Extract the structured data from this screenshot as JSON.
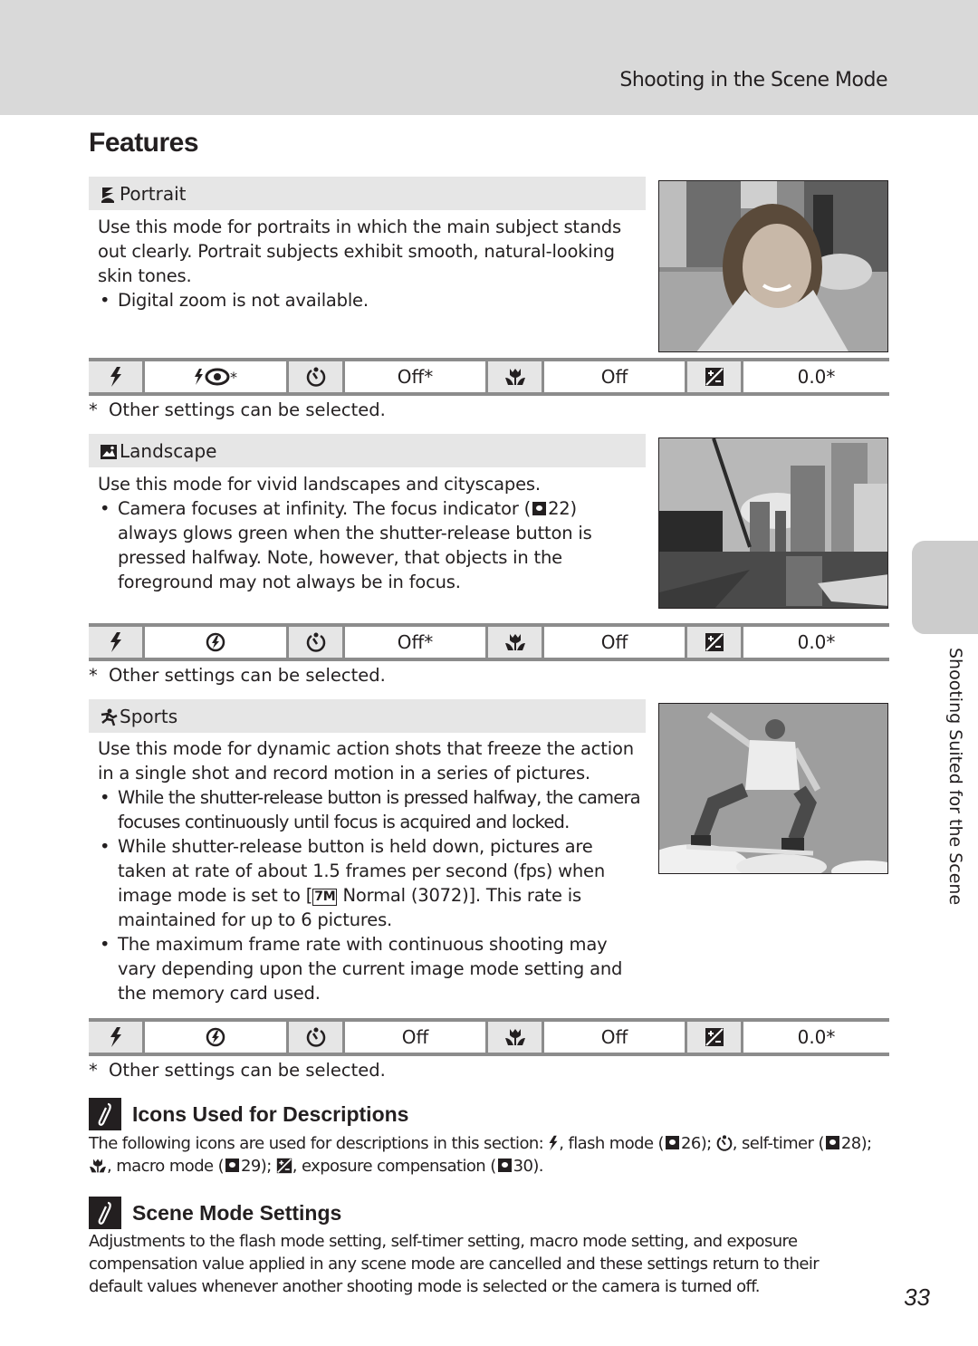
{
  "header": {
    "title": "Shooting in the Scene Mode"
  },
  "page_title": "Features",
  "sections": [
    {
      "id": "portrait",
      "icon": "portrait-mode-icon",
      "title": "Portrait",
      "intro": "Use this mode for portraits in which the main subject stands out clearly. Portrait subjects exhibit smooth, natural-looking skin tones.",
      "bullets": [
        "Digital zoom is not available."
      ],
      "photo_alt": "Smiling woman portrait in front of brick house",
      "settings": {
        "flash_value_icon": "red-eye-reduction-icon",
        "flash_value_suffix": "*",
        "self_timer": "Off*",
        "macro": "Off",
        "exposure": "0.0*"
      },
      "footnote": "Other settings can be selected."
    },
    {
      "id": "landscape",
      "icon": "landscape-mode-icon",
      "title": "Landscape",
      "intro": "Use this mode for vivid landscapes and cityscapes.",
      "bullets": [
        {
          "pre": "Camera focuses at infinity. The focus indicator (",
          "ref": "22",
          "post": ") always glows green when the shutter-release button is pressed halfway. Note, however, that objects in the foreground may not always be in focus."
        }
      ],
      "photo_alt": "Harbor with sailboats and city skyscrapers",
      "settings": {
        "flash_value_icon": "flash-off-icon",
        "flash_value_suffix": "",
        "self_timer": "Off*",
        "macro": "Off",
        "exposure": "0.0*"
      },
      "footnote": "Other settings can be selected."
    },
    {
      "id": "sports",
      "icon": "sports-mode-icon",
      "title": "Sports",
      "intro": "Use this mode for dynamic action shots that freeze the action in a single shot and record motion in a series of pictures.",
      "bullets": [
        "While the shutter-release button is pressed halfway, the camera focuses continuously until focus is acquired and locked.",
        {
          "pre": "While shutter-release button is held down, pictures are taken at rate of about 1.5 frames per second (fps) when image mode is set to [",
          "mode_badge": "7M",
          "post": " Normal (3072)]. This rate is maintained for up to 6 pictures."
        },
        "The maximum frame rate with continuous shooting may vary depending upon the current image mode setting and the memory card used."
      ],
      "photo_alt": "Skateboarder jumping against sky",
      "settings": {
        "flash_value_icon": "flash-off-icon",
        "flash_value_suffix": "",
        "self_timer": "Off",
        "macro": "Off",
        "exposure": "0.0*"
      },
      "footnote": "Other settings can be selected."
    }
  ],
  "footnote_marker": "*",
  "notes": [
    {
      "title": "Icons Used for Descriptions",
      "parts": {
        "p1": "The following icons are used for descriptions in this section: ",
        "p2": ", flash mode (",
        "r1": "26",
        "p3": "); ",
        "p4": ", self-timer (",
        "r2": "28",
        "p5": ");",
        "p6": ", macro mode (",
        "r3": "29",
        "p7": "); ",
        "p8": ", exposure compensation (",
        "r4": "30",
        "p9": ")."
      }
    },
    {
      "title": "Scene Mode Settings",
      "text": "Adjustments to the flash mode setting, self-timer setting, macro mode setting, and exposure compensation value applied in any scene mode are cancelled and these settings return to their default values whenever another shooting mode is selected or the camera is turned off."
    }
  ],
  "side_tab": {
    "label": "Shooting Suited for the Scene"
  },
  "page_number": "33"
}
